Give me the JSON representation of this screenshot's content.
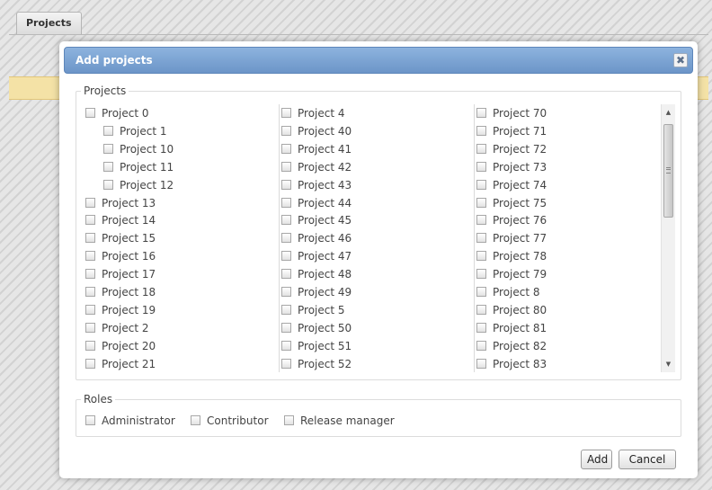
{
  "background": {
    "tab_label": "Projects"
  },
  "dialog": {
    "title": "Add projects",
    "close_glyph": "✖",
    "close_icon": "close-icon"
  },
  "projects": {
    "legend": "Projects",
    "columns": [
      [
        {
          "label": "Project 0",
          "indent": 0
        },
        {
          "label": "Project 1",
          "indent": 1
        },
        {
          "label": "Project 10",
          "indent": 1
        },
        {
          "label": "Project 11",
          "indent": 1
        },
        {
          "label": "Project 12",
          "indent": 1
        },
        {
          "label": "Project 13",
          "indent": 0
        },
        {
          "label": "Project 14",
          "indent": 0
        },
        {
          "label": "Project 15",
          "indent": 0
        },
        {
          "label": "Project 16",
          "indent": 0
        },
        {
          "label": "Project 17",
          "indent": 0
        },
        {
          "label": "Project 18",
          "indent": 0
        },
        {
          "label": "Project 19",
          "indent": 0
        },
        {
          "label": "Project 2",
          "indent": 0
        },
        {
          "label": "Project 20",
          "indent": 0
        },
        {
          "label": "Project 21",
          "indent": 0
        }
      ],
      [
        {
          "label": "Project 4",
          "indent": 0
        },
        {
          "label": "Project 40",
          "indent": 0
        },
        {
          "label": "Project 41",
          "indent": 0
        },
        {
          "label": "Project 42",
          "indent": 0
        },
        {
          "label": "Project 43",
          "indent": 0
        },
        {
          "label": "Project 44",
          "indent": 0
        },
        {
          "label": "Project 45",
          "indent": 0
        },
        {
          "label": "Project 46",
          "indent": 0
        },
        {
          "label": "Project 47",
          "indent": 0
        },
        {
          "label": "Project 48",
          "indent": 0
        },
        {
          "label": "Project 49",
          "indent": 0
        },
        {
          "label": "Project 5",
          "indent": 0
        },
        {
          "label": "Project 50",
          "indent": 0
        },
        {
          "label": "Project 51",
          "indent": 0
        },
        {
          "label": "Project 52",
          "indent": 0
        }
      ],
      [
        {
          "label": "Project 70",
          "indent": 0
        },
        {
          "label": "Project 71",
          "indent": 0
        },
        {
          "label": "Project 72",
          "indent": 0
        },
        {
          "label": "Project 73",
          "indent": 0
        },
        {
          "label": "Project 74",
          "indent": 0
        },
        {
          "label": "Project 75",
          "indent": 0
        },
        {
          "label": "Project 76",
          "indent": 0
        },
        {
          "label": "Project 77",
          "indent": 0
        },
        {
          "label": "Project 78",
          "indent": 0
        },
        {
          "label": "Project 79",
          "indent": 0
        },
        {
          "label": "Project 8",
          "indent": 0
        },
        {
          "label": "Project 80",
          "indent": 0
        },
        {
          "label": "Project 81",
          "indent": 0
        },
        {
          "label": "Project 82",
          "indent": 0
        },
        {
          "label": "Project 83",
          "indent": 0
        }
      ]
    ]
  },
  "scrollbar": {
    "up_glyph": "▲",
    "down_glyph": "▼"
  },
  "roles": {
    "legend": "Roles",
    "items": [
      "Administrator",
      "Contributor",
      "Release manager"
    ]
  },
  "buttons": {
    "add": "Add",
    "cancel": "Cancel"
  },
  "colors": {
    "titlebar": "#7aa1d2",
    "warning_strip": "#f4e2a6"
  }
}
